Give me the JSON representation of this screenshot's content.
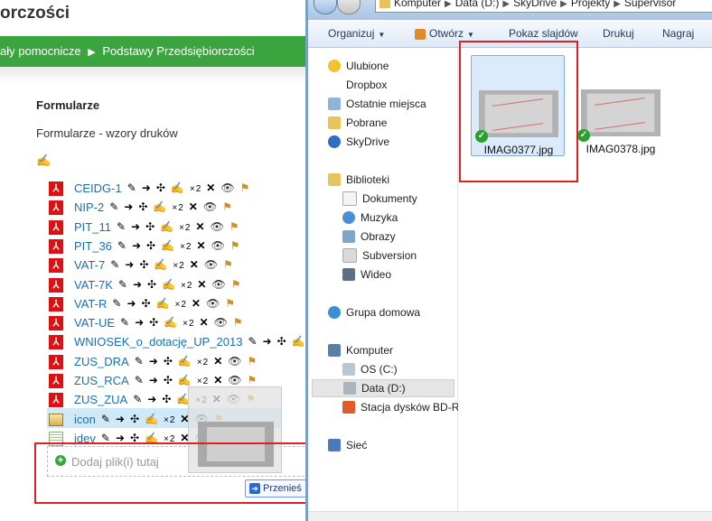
{
  "moodle": {
    "page_title": "orczości",
    "breadcrumb": [
      "ały pomocnicze",
      "Podstawy Przedsiębiorczości"
    ],
    "section": {
      "heading": "Formularze",
      "summary": "Formularze - wzory druków",
      "edit_glyph": "✍"
    },
    "files": [
      {
        "name": "CEIDG-1",
        "type": "pdf"
      },
      {
        "name": "NIP-2",
        "type": "pdf"
      },
      {
        "name": "PIT_11",
        "type": "pdf"
      },
      {
        "name": "PIT_36",
        "type": "pdf"
      },
      {
        "name": "VAT-7",
        "type": "pdf"
      },
      {
        "name": "VAT-7K",
        "type": "pdf"
      },
      {
        "name": "VAT-R",
        "type": "pdf"
      },
      {
        "name": "VAT-UE",
        "type": "pdf"
      },
      {
        "name": "WNIOSEK_o_dotację_UP_2013",
        "type": "pdf"
      },
      {
        "name": "ZUS_DRA",
        "type": "pdf"
      },
      {
        "name": "ZUS_RCA",
        "type": "pdf"
      },
      {
        "name": "ZUS_ZUA",
        "type": "pdf"
      },
      {
        "name": "icon",
        "type": "image"
      },
      {
        "name": "jdev",
        "type": "text"
      }
    ],
    "tools": {
      "edit": "✎",
      "move_right": "➜",
      "move": "✣",
      "edit_title": "✍",
      "duplicate": "×2",
      "delete": "✕",
      "show": "👁",
      "groups": "⚑"
    },
    "drop_zone_label": "Dodaj plik(i) tutaj",
    "move_button_label": "Przenieś",
    "accent_color": "#3aa43e",
    "link_color": "#1a6fb3"
  },
  "explorer": {
    "address": [
      "Komputer",
      "Data (D:)",
      "SkyDrive",
      "Projekty",
      "Supervisor"
    ],
    "toolbar": [
      {
        "label": "Organizuj",
        "dropdown": true
      },
      {
        "label": "Otwórz",
        "dropdown": true
      },
      {
        "label": "Pokaz slajdów",
        "dropdown": false
      },
      {
        "label": "Drukuj",
        "dropdown": false
      },
      {
        "label": "Nagraj",
        "dropdown": false
      }
    ],
    "nav": {
      "favorites_label": "Ulubione",
      "favorites": [
        "Dropbox",
        "Ostatnie miejsca",
        "Pobrane",
        "SkyDrive"
      ],
      "libraries_label": "Biblioteki",
      "libraries": [
        "Dokumenty",
        "Muzyka",
        "Obrazy",
        "Subversion",
        "Wideo"
      ],
      "homegroup_label": "Grupa domowa",
      "computer_label": "Komputer",
      "drives": [
        "OS (C:)",
        "Data (D:)",
        "Stacja dysków BD-R"
      ],
      "selected_drive": "Data (D:)",
      "network_label": "Sieć"
    },
    "files": [
      {
        "name": "IMAG0377.jpg",
        "selected": true,
        "synced": true
      },
      {
        "name": "IMAG0378.jpg",
        "selected": false,
        "synced": true
      }
    ]
  }
}
